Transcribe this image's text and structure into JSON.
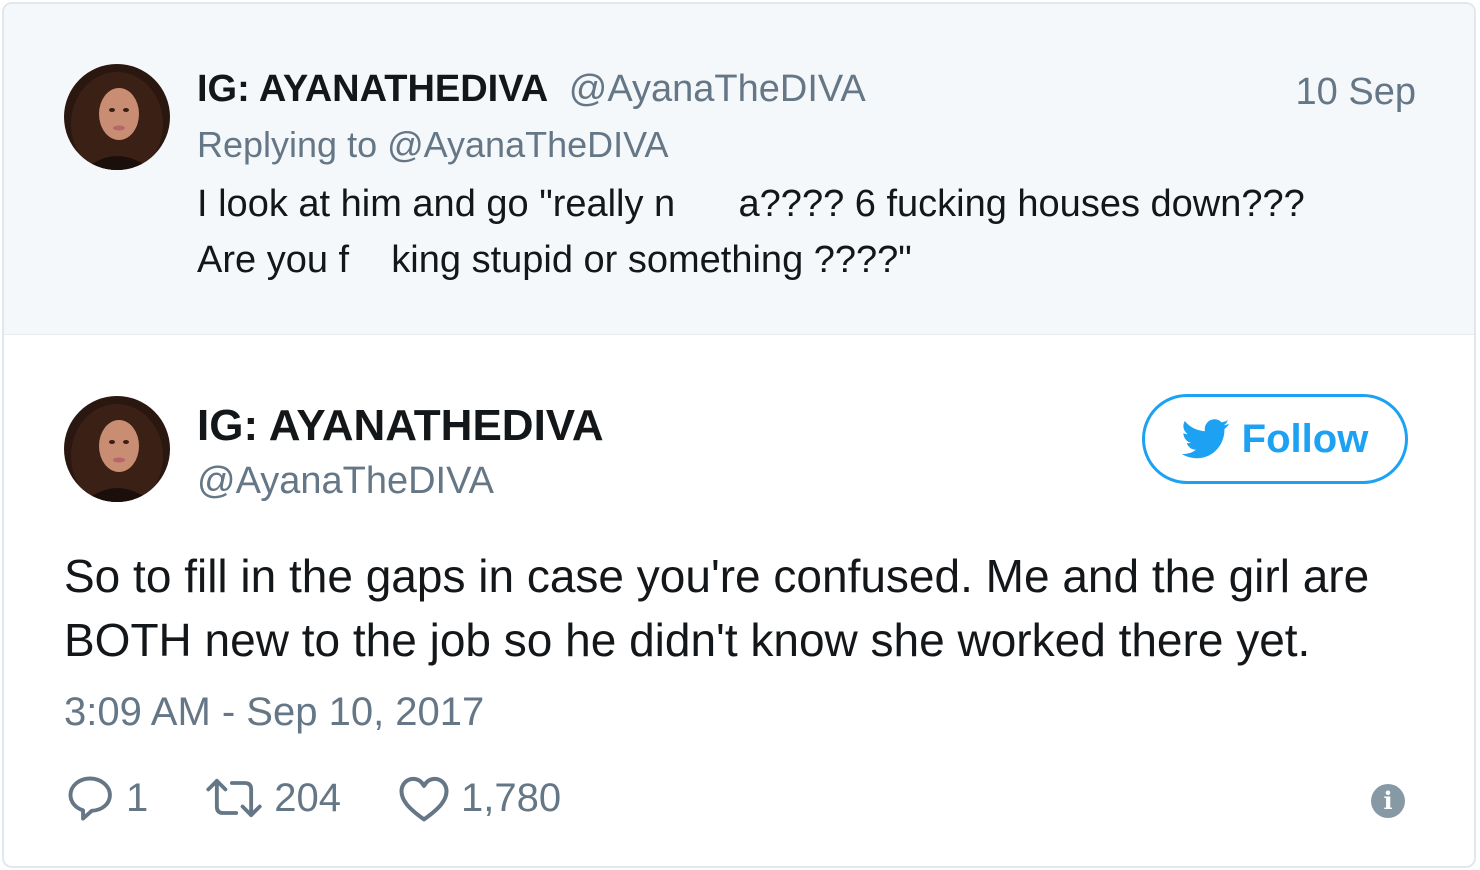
{
  "parent_tweet": {
    "display_name": "IG: AYANATHEDIVA",
    "handle": "@AyanaTheDIVA",
    "date": "10 Sep",
    "replying_prefix": "Replying to",
    "replying_handle": "@AyanaTheDIVA",
    "text_line1": "I look at him and go \"really n      a???? 6 fucking houses down???",
    "text_line2": "Are you f    king stupid or something ????\""
  },
  "main_tweet": {
    "display_name": "IG: AYANATHEDIVA",
    "handle": "@AyanaTheDIVA",
    "follow_label": "Follow",
    "text_line1": "So to fill in the gaps in case you're confused. Me and the girl are",
    "text_line2": "BOTH new to the job so he didn't know she worked there yet.",
    "timestamp": "3:09 AM - Sep 10, 2017",
    "replies": "1",
    "retweets": "204",
    "likes": "1,780"
  },
  "icons": {
    "reply": "reply-icon",
    "retweet": "retweet-icon",
    "like": "heart-icon",
    "info": "info-icon",
    "bird": "twitter-bird-icon"
  },
  "colors": {
    "accent": "#1da1f2",
    "secondary_text": "#657786",
    "parent_background": "#f5f8fa"
  }
}
